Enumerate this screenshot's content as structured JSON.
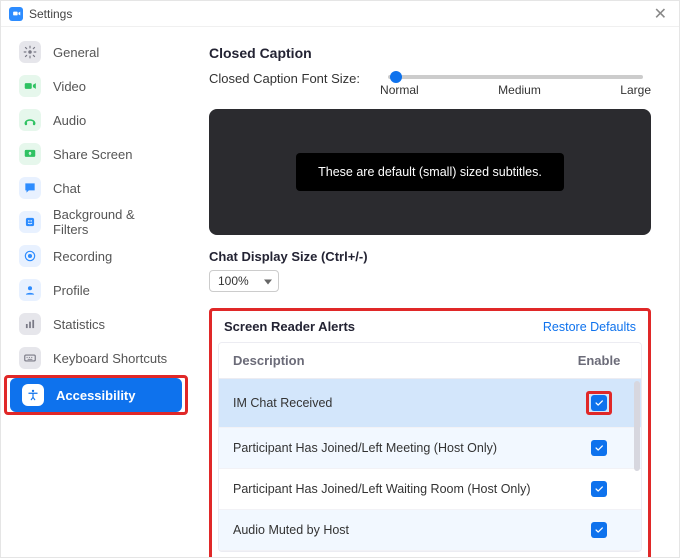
{
  "window": {
    "title": "Settings"
  },
  "sidebar": {
    "items": [
      {
        "id": "general",
        "label": "General",
        "bg": "#e6e6eb",
        "fg": "#7a7a86"
      },
      {
        "id": "video",
        "label": "Video",
        "bg": "#e6f7ec",
        "fg": "#2fc262"
      },
      {
        "id": "audio",
        "label": "Audio",
        "bg": "#e6f7ec",
        "fg": "#2fc262"
      },
      {
        "id": "share-screen",
        "label": "Share Screen",
        "bg": "#e6f7ec",
        "fg": "#2fc262"
      },
      {
        "id": "chat",
        "label": "Chat",
        "bg": "#e8f1ff",
        "fg": "#2d8cff"
      },
      {
        "id": "background-filters",
        "label": "Background & Filters",
        "bg": "#e8f1ff",
        "fg": "#2d8cff"
      },
      {
        "id": "recording",
        "label": "Recording",
        "bg": "#e8f1ff",
        "fg": "#2d8cff"
      },
      {
        "id": "profile",
        "label": "Profile",
        "bg": "#e8f1ff",
        "fg": "#2d8cff"
      },
      {
        "id": "statistics",
        "label": "Statistics",
        "bg": "#e6e6eb",
        "fg": "#7a7a86"
      },
      {
        "id": "keyboard-shortcuts",
        "label": "Keyboard Shortcuts",
        "bg": "#e6e6eb",
        "fg": "#7a7a86"
      },
      {
        "id": "accessibility",
        "label": "Accessibility",
        "bg": "#ffffff",
        "fg": "#0e72ed"
      }
    ],
    "active": "accessibility"
  },
  "closedCaption": {
    "title": "Closed Caption",
    "fontSizeLabel": "Closed Caption Font Size:",
    "ticks": [
      "Normal",
      "Medium",
      "Large"
    ],
    "value": 0,
    "previewText": "These are default (small) sized subtitles."
  },
  "chatSize": {
    "label": "Chat Display Size (Ctrl+/-)",
    "value": "100%"
  },
  "alerts": {
    "title": "Screen Reader Alerts",
    "restore": "Restore Defaults",
    "cols": {
      "desc": "Description",
      "enable": "Enable"
    },
    "rows": [
      {
        "desc": "IM Chat Received",
        "enabled": true,
        "selected": true,
        "highlight": true
      },
      {
        "desc": "Participant Has Joined/Left Meeting (Host Only)",
        "enabled": true,
        "alt": true
      },
      {
        "desc": "Participant Has Joined/Left Waiting Room (Host Only)",
        "enabled": true
      },
      {
        "desc": "Audio Muted by Host",
        "enabled": true,
        "alt": true
      }
    ]
  }
}
